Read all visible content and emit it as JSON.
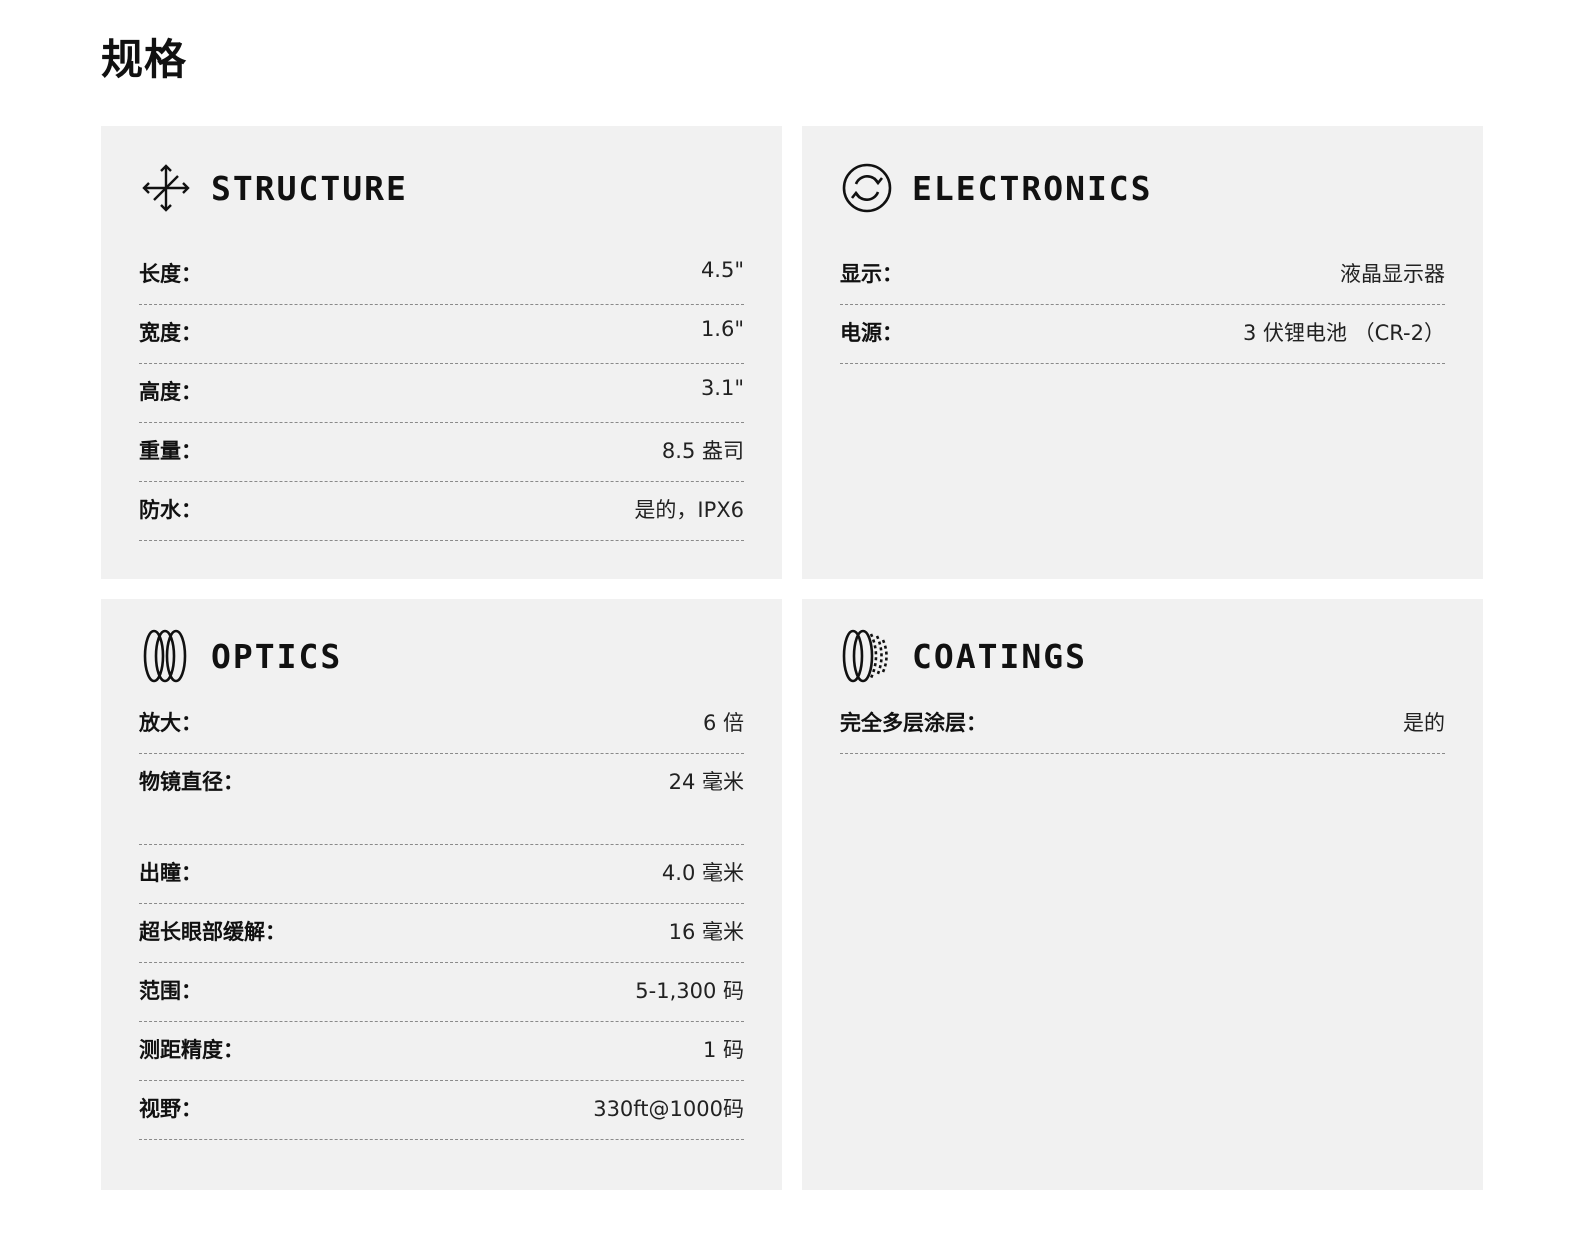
{
  "page": {
    "title": "规格"
  },
  "sections": {
    "structure": {
      "title": "STRUCTURE",
      "icon": "move-arrows-icon",
      "rows": [
        {
          "label": "长度：",
          "value": "4.5\""
        },
        {
          "label": "宽度：",
          "value": "1.6\""
        },
        {
          "label": "高度：",
          "value": "3.1\""
        },
        {
          "label": "重量：",
          "value": "8.5 盎司"
        },
        {
          "label": "防水：",
          "value": "是的，IPX6"
        }
      ]
    },
    "electronics": {
      "title": "ELECTRONICS",
      "icon": "refresh-circle-icon",
      "rows": [
        {
          "label": "显示：",
          "value": "液晶显示器"
        },
        {
          "label": "电源：",
          "value": "3 伏锂电池 （CR-2）"
        }
      ]
    },
    "optics": {
      "title": "OPTICS",
      "icon": "lens-rings-icon",
      "rows": [
        {
          "label": "放大：",
          "value": "6 倍"
        },
        {
          "label": "物镜直径：",
          "value": "24 毫米"
        },
        {
          "label": "出瞳：",
          "value": "4.0 毫米"
        },
        {
          "label": "超长眼部缓解：",
          "value": "16 毫米"
        },
        {
          "label": "范围：",
          "value": "5-1,300 码"
        },
        {
          "label": "测距精度：",
          "value": "1 码"
        },
        {
          "label": "视野：",
          "value": "330ft@1000码"
        }
      ]
    },
    "coatings": {
      "title": "COATINGS",
      "icon": "coated-lens-icon",
      "rows": [
        {
          "label": "完全多层涂层：",
          "value": "是的"
        }
      ]
    }
  }
}
